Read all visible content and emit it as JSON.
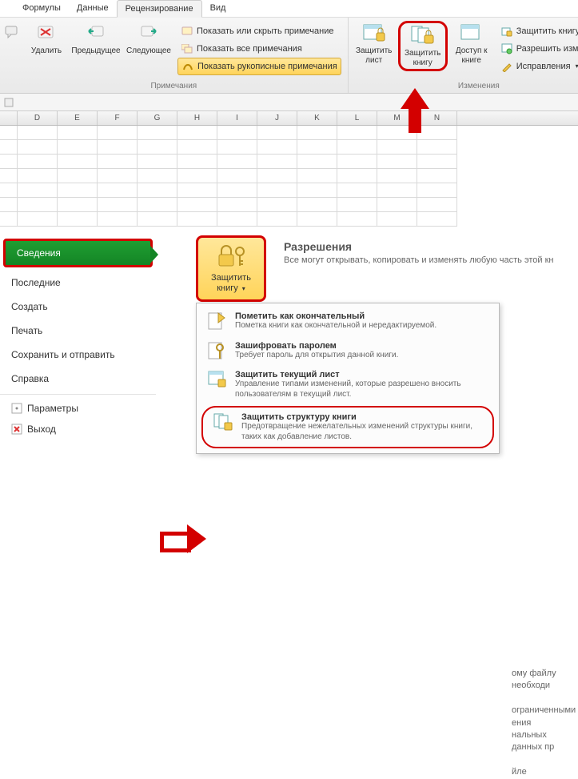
{
  "tabs": {
    "formulas": "Формулы",
    "data": "Данные",
    "review": "Рецензирование",
    "view": "Вид"
  },
  "ribbon": {
    "delete": "Удалить",
    "prev": "Предыдущее",
    "next": "Следующее",
    "group_notes_title": "Примечания",
    "show_hide_note": "Показать или скрыть примечание",
    "show_all_notes": "Показать все примечания",
    "show_ink": "Показать рукописные примечания",
    "protect_sheet": "Защитить лист",
    "protect_book": "Защитить книгу",
    "share_book": "Доступ к книге",
    "protect_share": "Защитить книгу и да",
    "allow_edit": "Разрешить измене",
    "track_changes": "Исправления",
    "group_changes_title": "Изменения"
  },
  "columns": [
    "",
    "D",
    "E",
    "F",
    "G",
    "H",
    "I",
    "J",
    "K",
    "L",
    "M",
    "N"
  ],
  "backstage": {
    "info": "Сведения",
    "recent": "Последние",
    "new": "Создать",
    "print": "Печать",
    "save_send": "Сохранить и отправить",
    "help": "Справка",
    "options": "Параметры",
    "exit": "Выход",
    "permissions_title": "Разрешения",
    "permissions_desc": "Все могут открывать, копировать и изменять любую часть этой кн",
    "protect_tile": "Защитить книгу",
    "menu": {
      "final_t": "Пометить как окончательный",
      "final_d": "Пометка книги как окончательной и нередактируемой.",
      "encrypt_t": "Зашифровать паролем",
      "encrypt_d": "Требует пароль для открытия данной книги.",
      "cur_sheet_t": "Защитить текущий лист",
      "cur_sheet_d": "Управление типами изменений, которые разрешено вносить пользователям в текущий лист.",
      "struct_t": "Защитить структуру книги",
      "struct_d": "Предотвращение нежелательных изменений структуры книги, таких как добавление листов."
    },
    "side1": "ому файлу необходи",
    "side2": "ограниченными",
    "side3": "ения",
    "side4": "нальных данных пр",
    "side5": "йле"
  }
}
